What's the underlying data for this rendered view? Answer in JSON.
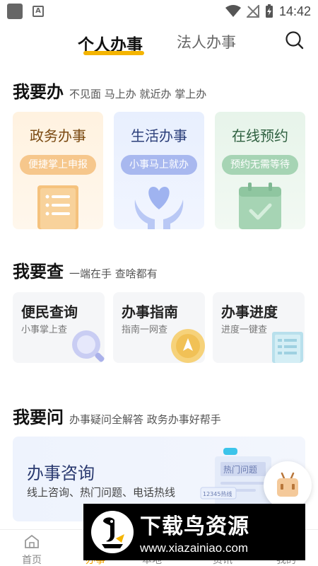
{
  "status_bar": {
    "time": "14:42"
  },
  "header": {
    "tabs": [
      {
        "label": "个人办事"
      },
      {
        "label": "法人办事"
      }
    ]
  },
  "section_do": {
    "title": "我要办",
    "subtitle": "不见面 马上办 就近办 掌上办",
    "cards": [
      {
        "title": "政务办事",
        "tag": "便捷掌上申报"
      },
      {
        "title": "生活办事",
        "tag": "小事马上就办"
      },
      {
        "title": "在线预约",
        "tag": "预约无需等待"
      }
    ]
  },
  "section_query": {
    "title": "我要查",
    "subtitle": "一端在手 查啥都有",
    "cards": [
      {
        "title": "便民查询",
        "desc": "小事掌上查"
      },
      {
        "title": "办事指南",
        "desc": "指南一网查"
      },
      {
        "title": "办事进度",
        "desc": "进度一键查"
      }
    ]
  },
  "section_ask": {
    "title": "我要问",
    "subtitle": "办事疑问全解答 政务办事好帮手",
    "banner_title": "办事咨询",
    "banner_desc": "线上咨询、热门问题、电话热线",
    "illus_doc": "热门问题",
    "illus_phone": "12345热线"
  },
  "bottom_nav": {
    "items": [
      {
        "label": "首页"
      },
      {
        "label": "办事"
      },
      {
        "label": "本地"
      },
      {
        "label": "资讯"
      },
      {
        "label": "我的"
      }
    ]
  },
  "watermark": {
    "main": "下载鸟资源",
    "url": "www.xiazainiao.com"
  },
  "colors": {
    "accent": "#f4b400",
    "watermark_bg": "#000000"
  }
}
